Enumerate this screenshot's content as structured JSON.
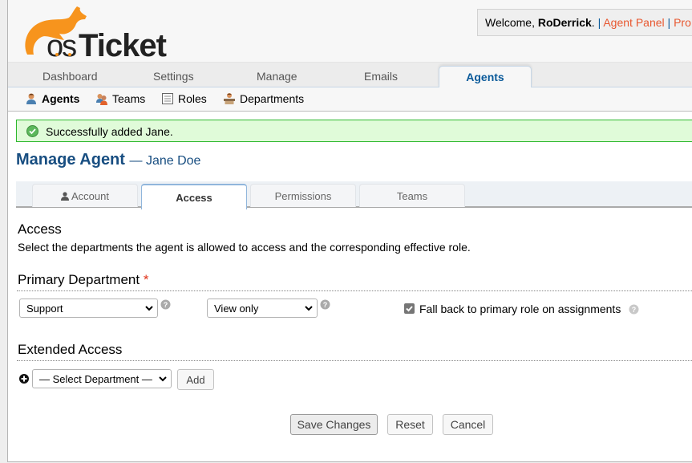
{
  "header": {
    "logo_text": "osTicket",
    "welcome_prefix": "Welcome, ",
    "username": "RoDerrick",
    "welcome_suffix": ".",
    "separator": "|",
    "links": [
      "Agent Panel",
      "Pro"
    ]
  },
  "nav": {
    "tabs": [
      {
        "label": "Dashboard",
        "active": false
      },
      {
        "label": "Settings",
        "active": false
      },
      {
        "label": "Manage",
        "active": false
      },
      {
        "label": "Emails",
        "active": false
      },
      {
        "label": "Agents",
        "active": true
      }
    ]
  },
  "subnav": {
    "items": [
      {
        "label": "Agents",
        "icon": "agent-icon",
        "active": true
      },
      {
        "label": "Teams",
        "icon": "teams-icon",
        "active": false
      },
      {
        "label": "Roles",
        "icon": "roles-icon",
        "active": false
      },
      {
        "label": "Departments",
        "icon": "department-icon",
        "active": false
      }
    ]
  },
  "message": {
    "type": "success",
    "text": "Successfully added Jane."
  },
  "page": {
    "title": "Manage Agent",
    "subtitle": "— Jane Doe"
  },
  "tabs": [
    {
      "label": "Account",
      "icon": "user-icon",
      "active": false
    },
    {
      "label": "Access",
      "active": true
    },
    {
      "label": "Permissions",
      "active": false
    },
    {
      "label": "Teams",
      "active": false
    }
  ],
  "access": {
    "title": "Access",
    "description": "Select the departments the agent is allowed to access and the corresponding effective role.",
    "primary": {
      "title": "Primary Department",
      "required_mark": "*",
      "department_value": "Support",
      "role_value": "View only",
      "fallback_label": "Fall back to primary role on assignments",
      "fallback_checked": true
    },
    "extended": {
      "title": "Extended Access",
      "select_placeholder": "— Select Department —",
      "add_label": "Add"
    }
  },
  "actions": {
    "save": "Save Changes",
    "reset": "Reset",
    "cancel": "Cancel"
  },
  "colors": {
    "brand_orange": "#f7941d",
    "title_blue": "#184e81",
    "link_orange": "#e8572f",
    "success_bg": "#e0fbd9",
    "success_border": "#2eb82e"
  }
}
